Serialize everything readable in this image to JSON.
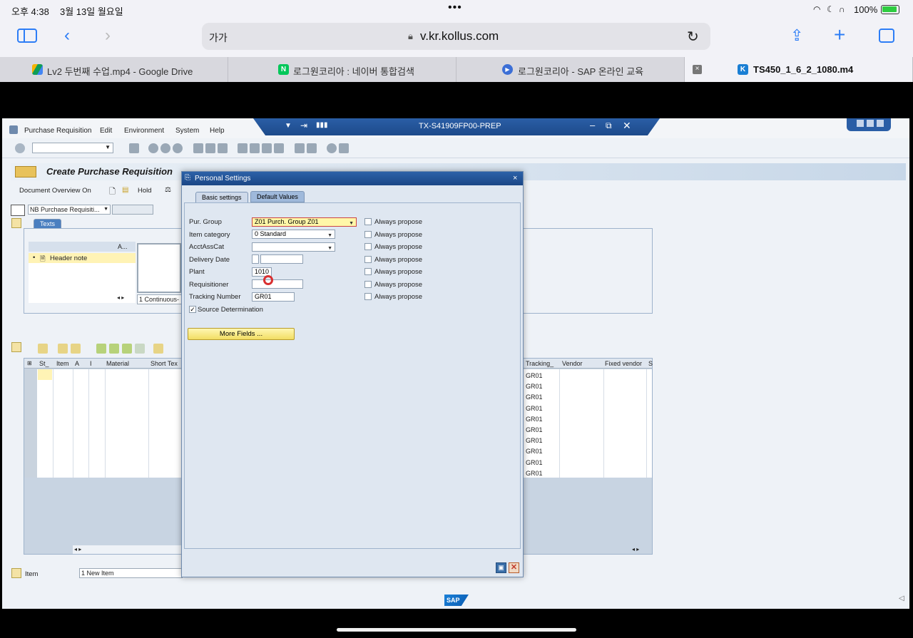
{
  "statusbar": {
    "time": "오후 4:38",
    "date": "3월 13일 월요일",
    "battery": "100%"
  },
  "browser": {
    "text_size": "가가",
    "url": "v.kr.kollus.com"
  },
  "tabs": [
    {
      "label": "Lv2 두번째 수업.mp4 - Google Drive",
      "icon": "google-drive-icon"
    },
    {
      "label": "로그원코리아 : 네이버 통합검색",
      "icon": "naver-icon"
    },
    {
      "label": "로그원코리아 - SAP 온라인 교육",
      "icon": "play-icon"
    },
    {
      "label": "TS450_1_6_2_1080.m4",
      "icon": "kollus-icon"
    }
  ],
  "sap": {
    "menu": [
      "Purchase Requisition",
      "Edit",
      "Environment",
      "System",
      "Help"
    ],
    "system_title": "TX-S41909FP00-PREP",
    "transaction_title": "Create Purchase Requisition",
    "app_toolbar": [
      "Document Overview On",
      "Hold"
    ],
    "doc_type": "NB Purchase Requisiti...",
    "texts_tab": "Texts",
    "text_col": "A...",
    "header_note": "Header note",
    "text_format": "1 Continuous-",
    "grid_headers_left": [
      "St_",
      "Item",
      "A",
      "I",
      "Material",
      "Short Tex"
    ],
    "grid_headers_right": [
      "Tracking_",
      "Vendor",
      "Fixed vendor",
      "S"
    ],
    "tracking_values": [
      "GR01",
      "GR01",
      "GR01",
      "GR01",
      "GR01",
      "GR01",
      "GR01",
      "GR01",
      "GR01",
      "GR01"
    ],
    "item_label": "Item",
    "item_value": "1 New Item",
    "logo": "SAP"
  },
  "dialog": {
    "title": "Personal Settings",
    "tabs": [
      "Basic settings",
      "Default Values"
    ],
    "fields": [
      {
        "label": "Pur. Group",
        "value": "Z01 Purch. Group Z01",
        "always": "Always propose"
      },
      {
        "label": "Item category",
        "value": "0 Standard",
        "always": "Always propose"
      },
      {
        "label": "AcctAssCat",
        "value": "",
        "always": "Always propose"
      },
      {
        "label": "Delivery Date",
        "value": "",
        "always": "Always propose"
      },
      {
        "label": "Plant",
        "value": "1010",
        "always": "Always propose"
      },
      {
        "label": "Requisitioner",
        "value": "",
        "always": "Always propose"
      },
      {
        "label": "Tracking Number",
        "value": "GR01",
        "always": "Always propose"
      }
    ],
    "source_determination": "Source Determination",
    "more_fields": "More Fields ..."
  }
}
